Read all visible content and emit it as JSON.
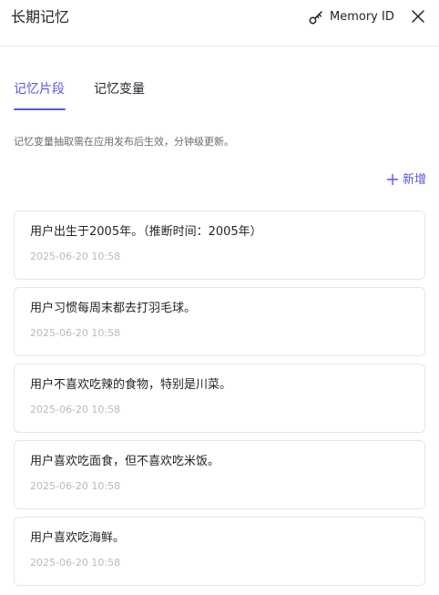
{
  "header": {
    "title": "长期记忆",
    "memory_id_label": "Memory ID"
  },
  "tabs": [
    {
      "label": "记忆片段",
      "active": true
    },
    {
      "label": "记忆变量",
      "active": false
    }
  ],
  "hint": "记忆变量抽取需在应用发布后生效，分钟级更新。",
  "add_label": "新增",
  "memories": [
    {
      "text": "用户出生于2005年。（推断时间：2005年）",
      "time": "2025-06-20 10:58"
    },
    {
      "text": "用户习惯每周末都去打羽毛球。",
      "time": "2025-06-20 10:58"
    },
    {
      "text": "用户不喜欢吃辣的食物，特别是川菜。",
      "time": "2025-06-20 10:58"
    },
    {
      "text": "用户喜欢吃面食，但不喜欢吃米饭。",
      "time": "2025-06-20 10:58"
    },
    {
      "text": "用户喜欢吃海鲜。",
      "time": "2025-06-20 10:58"
    }
  ],
  "colors": {
    "accent": "#5b55e6",
    "text": "#1f2329",
    "muted": "#646a73",
    "timestamp": "#b6bac1",
    "border": "#e4e6ea"
  },
  "icons": {
    "memory_id": "key-icon",
    "close": "close-icon",
    "add": "plus-icon"
  }
}
